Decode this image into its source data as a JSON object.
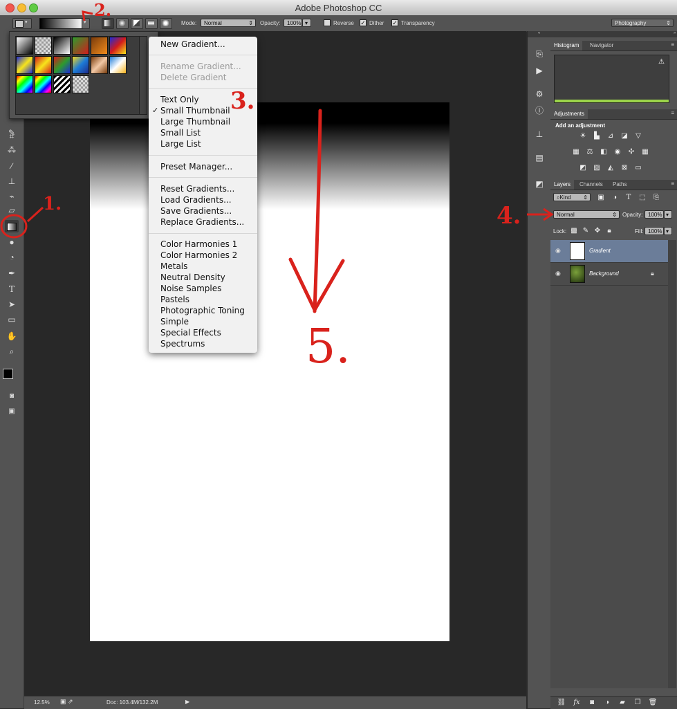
{
  "window": {
    "title": "Adobe Photoshop CC"
  },
  "options_bar": {
    "mode_label": "Mode:",
    "mode_value": "Normal",
    "opacity_label": "Opacity:",
    "opacity_value": "100%",
    "reverse_label": "Reverse",
    "reverse_checked": false,
    "dither_label": "Dither",
    "dither_checked": true,
    "transparency_label": "Transparency",
    "transparency_checked": true,
    "workspace": "Photography"
  },
  "gradient_menu": {
    "items": [
      {
        "label": "New Gradient...",
        "disabled": false
      },
      {
        "label": "Rename Gradient...",
        "disabled": true
      },
      {
        "label": "Delete Gradient",
        "disabled": true
      },
      {
        "label": "Text Only",
        "disabled": false
      },
      {
        "label": "Small Thumbnail",
        "disabled": false,
        "checked": true
      },
      {
        "label": "Large Thumbnail",
        "disabled": false
      },
      {
        "label": "Small List",
        "disabled": false
      },
      {
        "label": "Large List",
        "disabled": false
      },
      {
        "label": "Preset Manager...",
        "disabled": false
      },
      {
        "label": "Reset Gradients...",
        "disabled": false
      },
      {
        "label": "Load Gradients...",
        "disabled": false
      },
      {
        "label": "Save Gradients...",
        "disabled": false
      },
      {
        "label": "Replace Gradients...",
        "disabled": false
      },
      {
        "label": "Color Harmonies 1",
        "disabled": false
      },
      {
        "label": "Color Harmonies 2",
        "disabled": false
      },
      {
        "label": "Metals",
        "disabled": false
      },
      {
        "label": "Neutral Density",
        "disabled": false
      },
      {
        "label": "Noise Samples",
        "disabled": false
      },
      {
        "label": "Pastels",
        "disabled": false
      },
      {
        "label": "Photographic Toning",
        "disabled": false
      },
      {
        "label": "Simple",
        "disabled": false
      },
      {
        "label": "Special Effects",
        "disabled": false
      },
      {
        "label": "Spectrums",
        "disabled": false
      }
    ]
  },
  "panels": {
    "histogram_tab": "Histogram",
    "navigator_tab": "Navigator",
    "adjustments_tab": "Adjustments",
    "adjustments_hint": "Add an adjustment",
    "layers_tab": "Layers",
    "channels_tab": "Channels",
    "paths_tab": "Paths",
    "kind_filter": "Kind",
    "blend_mode": "Normal",
    "opacity_label": "Opacity:",
    "opacity_value": "100%",
    "lock_label": "Lock:",
    "fill_label": "Fill:",
    "fill_value": "100%",
    "layers": [
      {
        "name": "Gradient",
        "selected": true
      },
      {
        "name": "Background",
        "selected": false,
        "locked": true
      }
    ]
  },
  "status_bar": {
    "zoom": "12.5%",
    "doc_info": "Doc: 103.4M/132.2M"
  },
  "annotations": {
    "a1": "1.",
    "a2": "2.",
    "a3": "3.",
    "a4": "4.",
    "a5": "5."
  },
  "colors": {
    "annotation": "#d9221c",
    "panel_bg": "#535353",
    "selected_layer": "#6b7d99"
  }
}
